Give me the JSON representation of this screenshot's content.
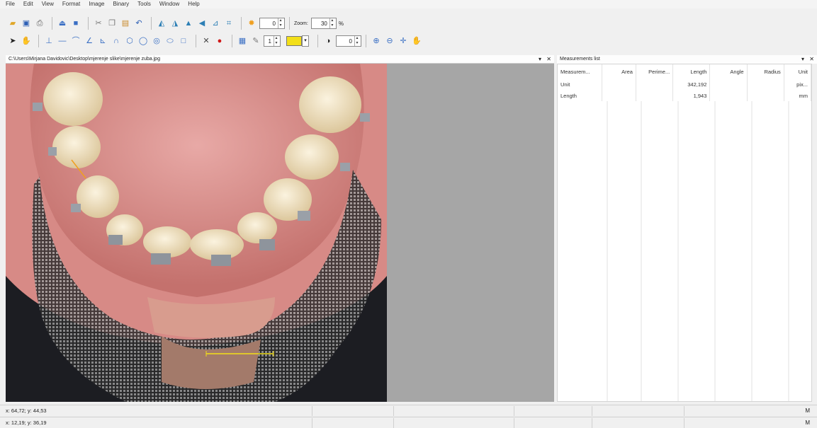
{
  "menu": [
    "File",
    "Edit",
    "View",
    "Format",
    "Image",
    "Binary",
    "Tools",
    "Window",
    "Help"
  ],
  "toolbar": {
    "brightness_value": "0",
    "contrast_value": "0",
    "zoom_label": "Zoom:",
    "zoom_value": "30",
    "zoom_unit": "%",
    "line_width_value": "1",
    "line_color": "#f3df18"
  },
  "image_panel": {
    "title": "C:\\Users\\Mirjana Davidovic\\Desktop\\mjerenje slike\\mjerenje zuba.jpg",
    "pin": "▾",
    "close": "✕"
  },
  "measurements": {
    "title": "Measurements list",
    "pin": "▾",
    "close": "✕",
    "columns": [
      "Measurem...",
      "Area",
      "Perime...",
      "Length",
      "Angle",
      "Radius",
      "Unit"
    ],
    "rows": [
      [
        "Unit",
        "",
        "",
        "342,192",
        "",
        "",
        "pix..."
      ],
      [
        "Length",
        "",
        "",
        "1,943",
        "",
        "",
        "mm"
      ]
    ]
  },
  "status": {
    "line1": "x: 64,72; y: 44,53",
    "line2": "x: 12,19; y: 36,19",
    "mode1": "M",
    "mode2": "M"
  }
}
